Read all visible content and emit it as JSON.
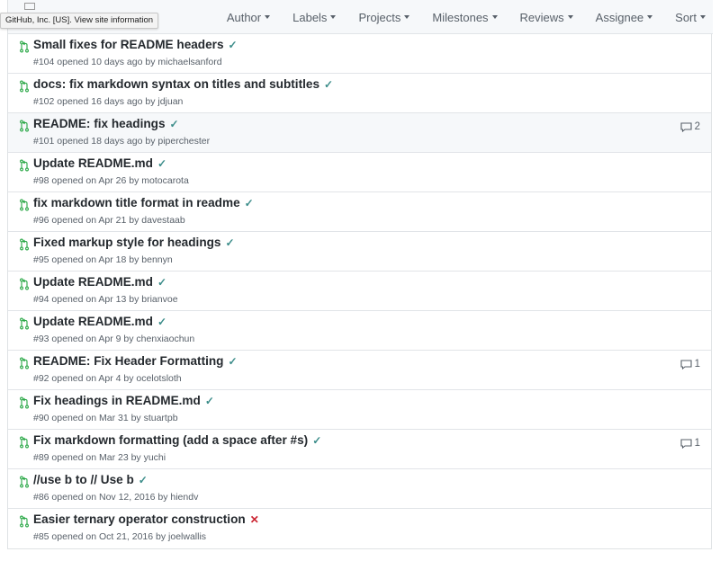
{
  "tooltip": "GitHub, Inc. [US]. View site information",
  "filters": [
    "Author",
    "Labels",
    "Projects",
    "Milestones",
    "Reviews",
    "Assignee",
    "Sort"
  ],
  "colors": {
    "check": "#3c8d8a",
    "cross": "#cb2431",
    "meta": "#586069"
  },
  "pull_requests": [
    {
      "title": "Small fixes for README headers",
      "meta": "#104 opened 10 days ago by michaelsanford",
      "status": "success",
      "status_icon": "✓",
      "comments": ""
    },
    {
      "title": "docs: fix markdown syntax on titles and subtitles",
      "meta": "#102 opened 16 days ago by jdjuan",
      "status": "success",
      "status_icon": "✓",
      "comments": ""
    },
    {
      "title": "README: fix headings",
      "meta": "#101 opened 18 days ago by piperchester",
      "status": "success",
      "status_icon": "✓",
      "comments": "2"
    },
    {
      "title": "Update README.md",
      "meta": "#98 opened on Apr 26 by motocarota",
      "status": "success",
      "status_icon": "✓",
      "comments": ""
    },
    {
      "title": "fix markdown title format in readme",
      "meta": "#96 opened on Apr 21 by davestaab",
      "status": "success",
      "status_icon": "✓",
      "comments": ""
    },
    {
      "title": "Fixed markup style for headings",
      "meta": "#95 opened on Apr 18 by bennyn",
      "status": "success",
      "status_icon": "✓",
      "comments": ""
    },
    {
      "title": "Update README.md",
      "meta": "#94 opened on Apr 13 by brianvoe",
      "status": "success",
      "status_icon": "✓",
      "comments": ""
    },
    {
      "title": "Update README.md",
      "meta": "#93 opened on Apr 9 by chenxiaochun",
      "status": "success",
      "status_icon": "✓",
      "comments": ""
    },
    {
      "title": "README: Fix Header Formatting",
      "meta": "#92 opened on Apr 4 by ocelotsloth",
      "status": "success",
      "status_icon": "✓",
      "comments": "1"
    },
    {
      "title": "Fix headings in README.md",
      "meta": "#90 opened on Mar 31 by stuartpb",
      "status": "success",
      "status_icon": "✓",
      "comments": ""
    },
    {
      "title": "Fix markdown formatting (add a space after #s)",
      "meta": "#89 opened on Mar 23 by yuchi",
      "status": "success",
      "status_icon": "✓",
      "comments": "1"
    },
    {
      "title": "//use b to // Use b",
      "meta": "#86 opened on Nov 12, 2016 by hiendv",
      "status": "success",
      "status_icon": "✓",
      "comments": ""
    },
    {
      "title": "Easier ternary operator construction",
      "meta": "#85 opened on Oct 21, 2016 by joelwallis",
      "status": "failure",
      "status_icon": "✕",
      "comments": ""
    }
  ]
}
